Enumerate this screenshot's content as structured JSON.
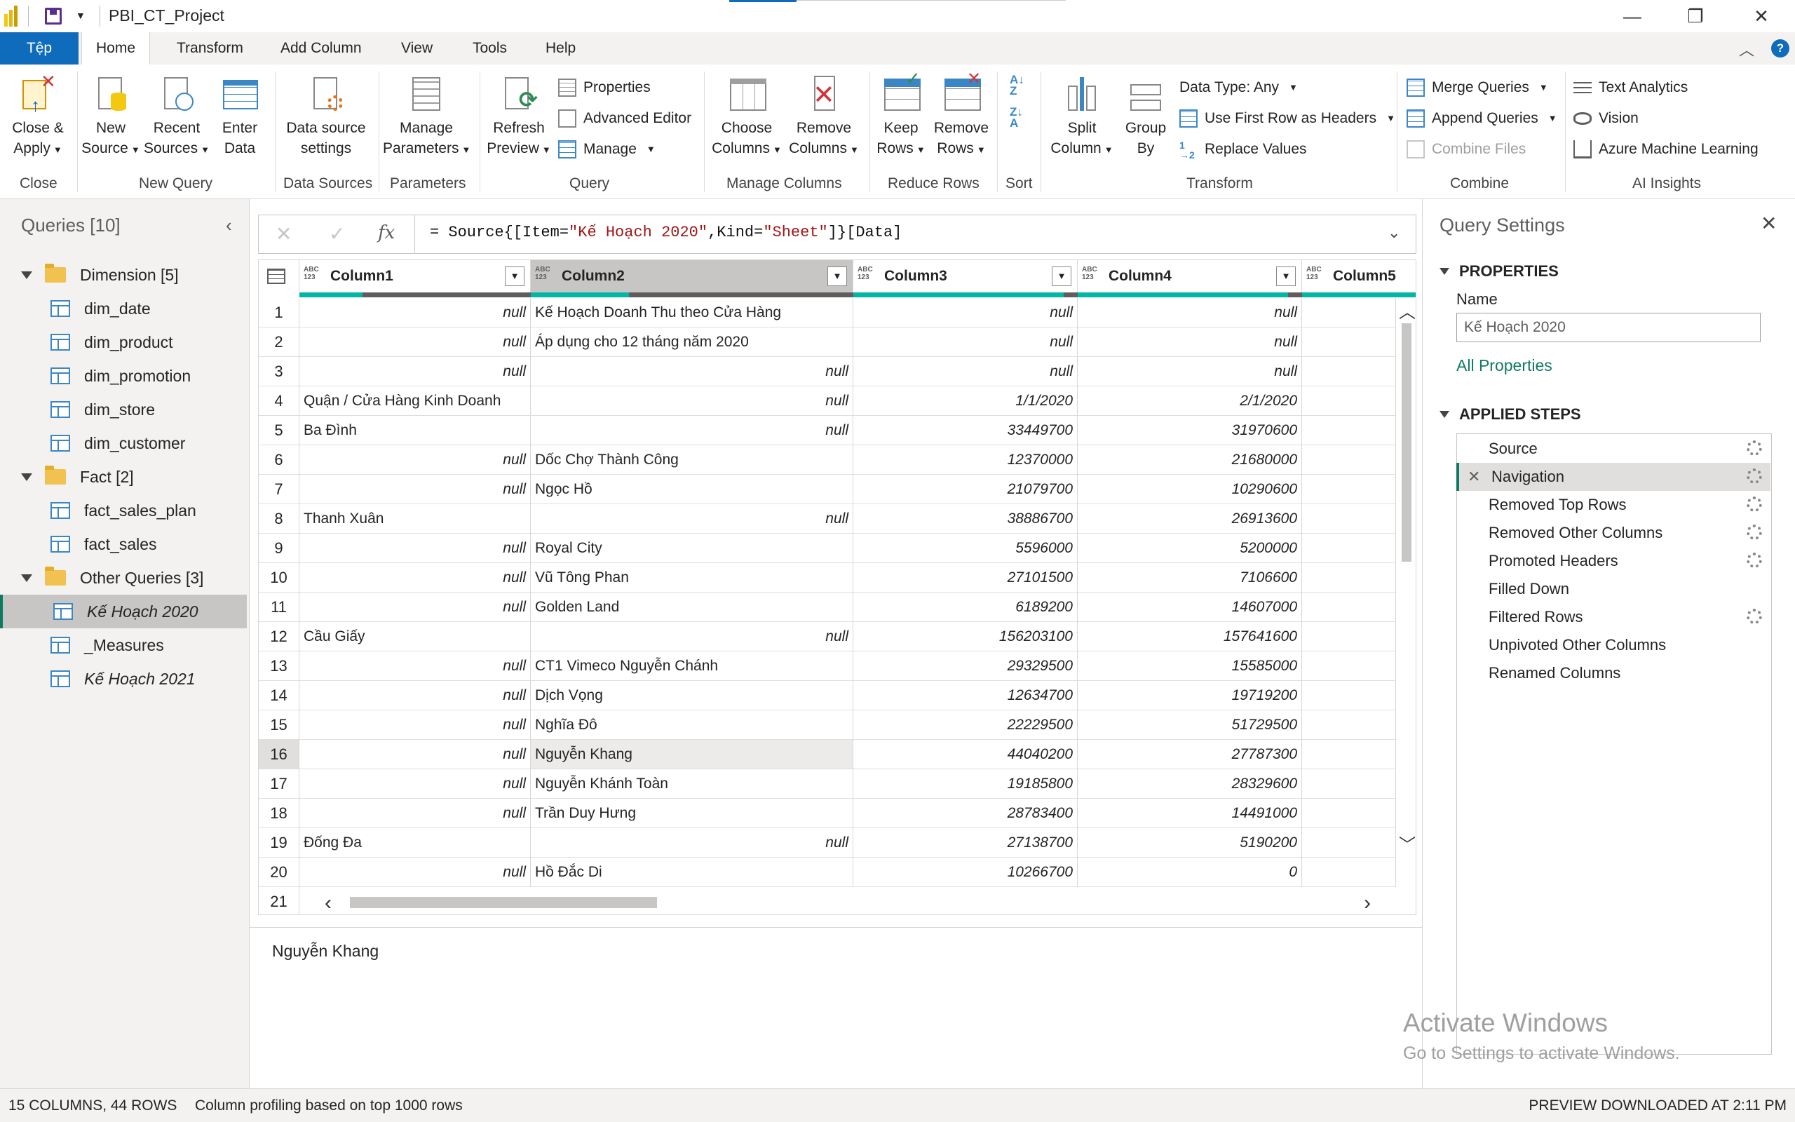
{
  "window": {
    "title": "PBI_CT_Project"
  },
  "tabs": [
    "Tệp",
    "Home",
    "Transform",
    "Add Column",
    "View",
    "Tools",
    "Help"
  ],
  "ribbon": {
    "close_group": {
      "btn": "Close &",
      "btn2": "Apply",
      "label": "Close"
    },
    "new_query": {
      "new_source": [
        "New",
        "Source"
      ],
      "recent_sources": [
        "Recent",
        "Sources"
      ],
      "enter_data": [
        "Enter",
        "Data"
      ],
      "label": "New Query"
    },
    "data_sources": {
      "settings": [
        "Data source",
        "settings"
      ],
      "label": "Data Sources"
    },
    "parameters": {
      "manage": [
        "Manage",
        "Parameters"
      ],
      "label": "Parameters"
    },
    "query": {
      "refresh": [
        "Refresh",
        "Preview"
      ],
      "properties": "Properties",
      "advanced_editor": "Advanced Editor",
      "manage": "Manage",
      "label": "Query"
    },
    "manage_columns": {
      "choose": [
        "Choose",
        "Columns"
      ],
      "remove": [
        "Remove",
        "Columns"
      ],
      "label": "Manage Columns"
    },
    "reduce_rows": {
      "keep": [
        "Keep",
        "Rows"
      ],
      "remove": [
        "Remove",
        "Rows"
      ],
      "label": "Reduce Rows"
    },
    "sort": {
      "label": "Sort"
    },
    "transform": {
      "split": [
        "Split",
        "Column"
      ],
      "group": [
        "Group",
        "By"
      ],
      "data_type": "Data Type: Any",
      "first_row": "Use First Row as Headers",
      "replace": "Replace Values",
      "label": "Transform"
    },
    "combine": {
      "merge": "Merge Queries",
      "append": "Append Queries",
      "combine_files": "Combine Files",
      "label": "Combine"
    },
    "ai": {
      "text": "Text Analytics",
      "vision": "Vision",
      "azure": "Azure Machine Learning",
      "label": "AI Insights"
    }
  },
  "queries": {
    "header": "Queries [10]",
    "groups": [
      {
        "name": "Dimension [5]",
        "items": [
          "dim_date",
          "dim_product",
          "dim_promotion",
          "dim_store",
          "dim_customer"
        ]
      },
      {
        "name": "Fact [2]",
        "items": [
          "fact_sales_plan",
          "fact_sales"
        ]
      },
      {
        "name": "Other Queries [3]",
        "items": [
          "Kế Hoạch 2020",
          "_Measures",
          "Kế Hoạch 2021"
        ]
      }
    ],
    "selected": "Kế Hoạch 2020"
  },
  "formula": {
    "prefix": "= Source{[Item=",
    "item": "\"Kế Hoạch 2020\"",
    "mid": ",Kind=",
    "kind": "\"Sheet\"",
    "suffix": "]}[Data]"
  },
  "grid": {
    "type_label_top": "ABC",
    "type_label_bottom": "123",
    "columns": [
      "Column1",
      "Column2",
      "Column3",
      "Column4",
      "Column5"
    ],
    "selected_column": "Column2",
    "selected_row": 16,
    "rows": [
      [
        "null",
        "Kế Hoạch Doanh Thu theo Cửa Hàng",
        "null",
        "null"
      ],
      [
        "null",
        "Áp dụng cho 12 tháng năm 2020",
        "null",
        "null"
      ],
      [
        "null",
        "null",
        "null",
        "null"
      ],
      [
        "Quận / Cửa Hàng Kinh Doanh",
        "null",
        "1/1/2020",
        "2/1/2020"
      ],
      [
        "Ba Đình",
        "null",
        "33449700",
        "31970600"
      ],
      [
        "null",
        "Dốc Chợ Thành Công",
        "12370000",
        "21680000"
      ],
      [
        "null",
        "Ngọc Hồ",
        "21079700",
        "10290600"
      ],
      [
        "Thanh Xuân",
        "null",
        "38886700",
        "26913600"
      ],
      [
        "null",
        "Royal City",
        "5596000",
        "5200000"
      ],
      [
        "null",
        "Vũ Tông Phan",
        "27101500",
        "7106600"
      ],
      [
        "null",
        "Golden Land",
        "6189200",
        "14607000"
      ],
      [
        "Cầu Giấy",
        "null",
        "156203100",
        "157641600"
      ],
      [
        "null",
        "CT1 Vimeco Nguyễn Chánh",
        "29329500",
        "15585000"
      ],
      [
        "null",
        "Dịch Vọng",
        "12634700",
        "19719200"
      ],
      [
        "null",
        "Nghĩa Đô",
        "22229500",
        "51729500"
      ],
      [
        "null",
        "Nguyễn Khang",
        "44040200",
        "27787300"
      ],
      [
        "null",
        "Nguyễn Khánh Toàn",
        "19185800",
        "28329600"
      ],
      [
        "null",
        "Trần Duy Hưng",
        "28783400",
        "14491000"
      ],
      [
        "Đống Đa",
        "null",
        "27138700",
        "5190200"
      ],
      [
        "null",
        "Hồ Đắc Di",
        "10266700",
        "0"
      ]
    ]
  },
  "detail": {
    "value": "Nguyễn Khang"
  },
  "settings": {
    "title": "Query Settings",
    "properties_label": "PROPERTIES",
    "name_label": "Name",
    "name_value": "Kế Hoạch 2020",
    "all_properties": "All Properties",
    "applied_steps_label": "APPLIED STEPS",
    "steps": [
      "Source",
      "Navigation",
      "Removed Top Rows",
      "Removed Other Columns",
      "Promoted Headers",
      "Filled Down",
      "Filtered Rows",
      "Unpivoted Other Columns",
      "Renamed Columns"
    ],
    "selected_step": "Navigation"
  },
  "watermark": {
    "line1": "Activate Windows",
    "line2": "Go to Settings to activate Windows."
  },
  "status": {
    "left": "15 COLUMNS, 44 ROWS",
    "profiling": "Column profiling based on top 1000 rows",
    "right": "PREVIEW DOWNLOADED AT 2:11 PM"
  }
}
